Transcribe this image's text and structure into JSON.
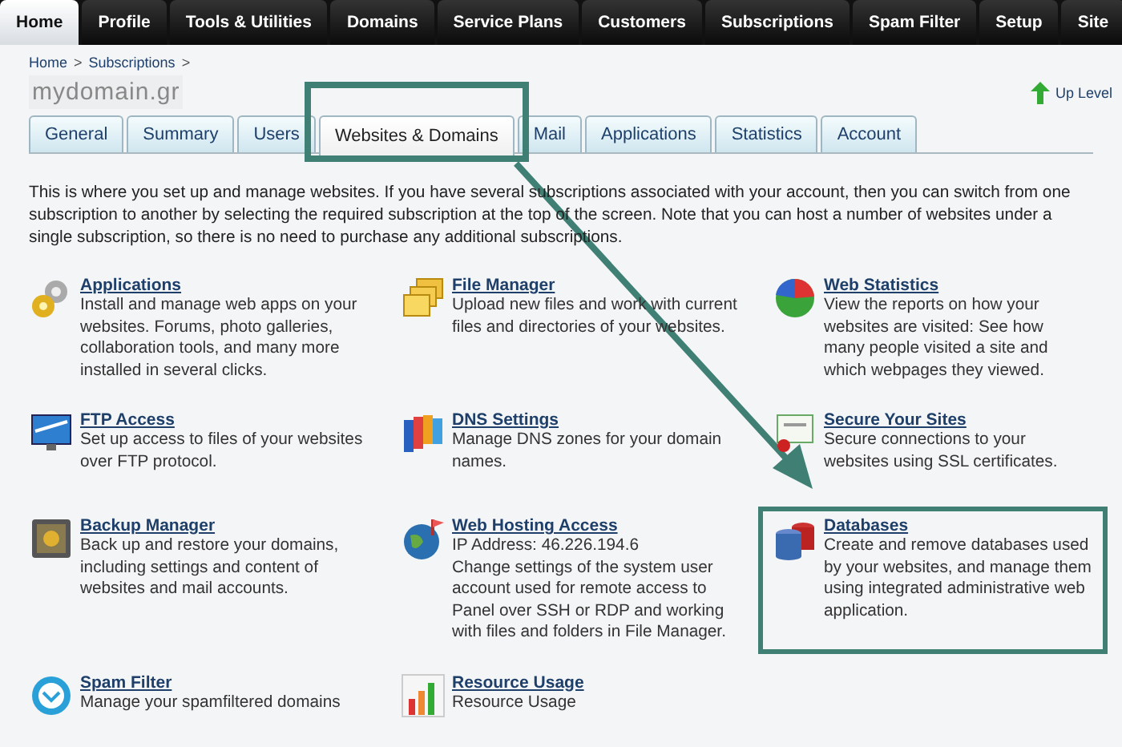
{
  "top_nav": [
    {
      "label": "Home",
      "selected": true
    },
    {
      "label": "Profile",
      "selected": false
    },
    {
      "label": "Tools & Utilities",
      "selected": false
    },
    {
      "label": "Domains",
      "selected": false
    },
    {
      "label": "Service Plans",
      "selected": false
    },
    {
      "label": "Customers",
      "selected": false
    },
    {
      "label": "Subscriptions",
      "selected": false
    },
    {
      "label": "Spam Filter",
      "selected": false
    },
    {
      "label": "Setup",
      "selected": false
    },
    {
      "label": "Site",
      "selected": false
    }
  ],
  "breadcrumb": [
    {
      "label": "Home",
      "separator": ">"
    },
    {
      "label": "Subscriptions",
      "separator": ">"
    }
  ],
  "page_title": "mydomain.gr",
  "up_level": "Up Level",
  "tabs": [
    {
      "label": "General",
      "selected": false,
      "highlighted": false
    },
    {
      "label": "Summary",
      "selected": false,
      "highlighted": false
    },
    {
      "label": "Users",
      "selected": false,
      "highlighted": false
    },
    {
      "label": "Websites & Domains",
      "selected": true,
      "highlighted": true
    },
    {
      "label": "Mail",
      "selected": false,
      "highlighted": false
    },
    {
      "label": "Applications",
      "selected": false,
      "highlighted": false
    },
    {
      "label": "Statistics",
      "selected": false,
      "highlighted": false
    },
    {
      "label": "Account",
      "selected": false,
      "highlighted": false
    }
  ],
  "intro": "This is where you set up and manage websites. If you have several subscriptions associated with your account, then you can switch from one subscription to another by selecting the required subscription at the top of the screen. Note that you can host a number of websites under a single subscription, so there is no need to purchase any additional subscriptions.",
  "features": [
    {
      "kind": "gears",
      "title": "Applications",
      "description": "Install and manage web apps on your websites. Forums, photo galleries, collaboration tools, and many more installed in several clicks.",
      "highlighted": false
    },
    {
      "kind": "folders",
      "title": "File Manager",
      "description": "Upload new files and work with current files and directories of your websites.",
      "highlighted": false
    },
    {
      "kind": "pie",
      "title": "Web Statistics",
      "description": "View the reports on how your websites are visited: See how many people visited a site and which webpages they viewed.",
      "highlighted": false
    },
    {
      "kind": "monitor",
      "title": "FTP Access",
      "description": "Set up access to files of your websites over FTP protocol.",
      "highlighted": false
    },
    {
      "kind": "books",
      "title": "DNS Settings",
      "description": "Manage DNS zones for your domain names.",
      "highlighted": false
    },
    {
      "kind": "certificate",
      "title": "Secure Your Sites",
      "description": "Secure connections to your websites using SSL certificates.",
      "highlighted": false
    },
    {
      "kind": "safe",
      "title": "Backup Manager",
      "description": "Back up and restore your domains, including settings and content of websites and mail accounts.",
      "highlighted": false
    },
    {
      "kind": "globe",
      "title": "Web Hosting Access",
      "description": "IP Address: 46.226.194.6\nChange settings of the system user account used for remote access to Panel over SSH or RDP and working with files and folders in File Manager.",
      "highlighted": false
    },
    {
      "kind": "database",
      "title": "Databases",
      "description": "Create and remove databases used by your websites, and manage them using integrated administrative web application.",
      "highlighted": true
    },
    {
      "kind": "shield",
      "title": "Spam Filter",
      "description": "Manage your spamfiltered domains",
      "highlighted": false
    },
    {
      "kind": "barchart",
      "title": "Resource Usage",
      "description": "Resource Usage",
      "highlighted": false
    }
  ]
}
